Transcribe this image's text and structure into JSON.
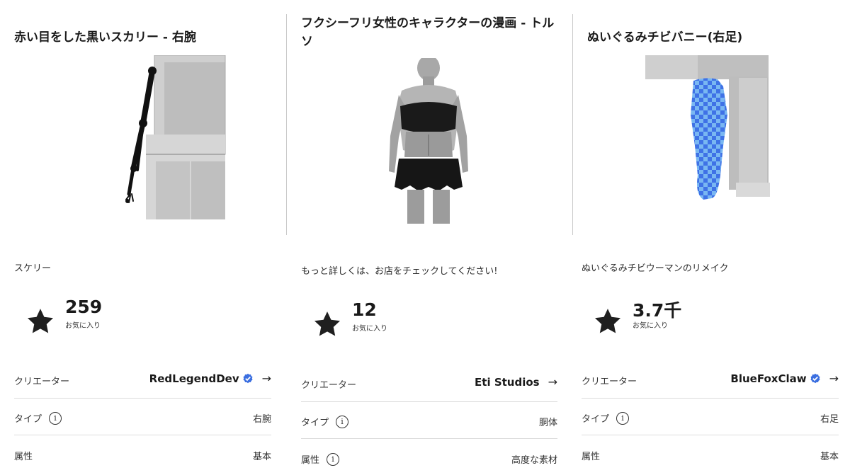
{
  "panels": [
    {
      "title": "赤い目をした黒いスカリー - 右腕",
      "description": "スケリー",
      "favorites": {
        "count": "259",
        "label": "お気に入り"
      },
      "details": {
        "creator_label": "クリエーター",
        "creator": "RedLegendDev",
        "creator_verified": true,
        "type_label": "タイプ",
        "type_value": "右腕",
        "attr_label": "属性",
        "attr_value": "基本"
      }
    },
    {
      "title": "フクシーフリ女性のキャラクターの漫画 - トルソ",
      "description": "もっと詳しくは、お店をチェックしてください!",
      "favorites": {
        "count": "12",
        "label": "お気に入り"
      },
      "details": {
        "creator_label": "クリエーター",
        "creator": "Eti Studios",
        "creator_verified": false,
        "type_label": "タイプ",
        "type_value": "胴体",
        "attr_label": "属性",
        "attr_value": "高度な素材"
      }
    },
    {
      "title": "ぬいぐるみチビバニー(右足)",
      "description": "ぬいぐるみチビウーマンのリメイク",
      "favorites": {
        "count": "3.7千",
        "label": "お気に入り"
      },
      "details": {
        "creator_label": "クリエーター",
        "creator": "BlueFoxClaw",
        "creator_verified": true,
        "type_label": "タイプ",
        "type_value": "右足",
        "attr_label": "属性",
        "attr_value": "基本"
      }
    }
  ],
  "icons": {
    "favorite": "star-icon",
    "info": "info-icon",
    "verified": "verified-badge-icon",
    "navigate": "arrow-right-icon"
  },
  "info_glyph": "i",
  "arrow_glyph": "→",
  "colors": {
    "verified_badge": "#3b6fe0",
    "divider": "#dcdcdc",
    "text": "#1a1a1a"
  }
}
